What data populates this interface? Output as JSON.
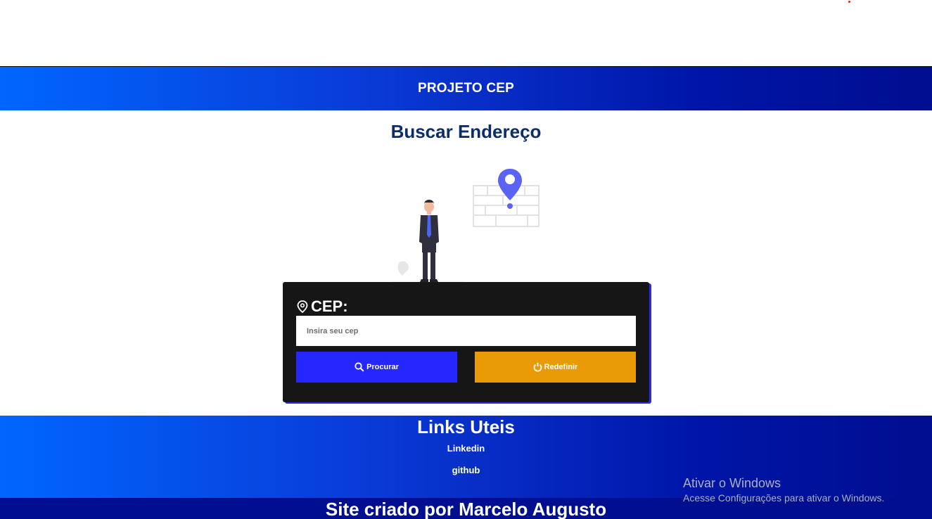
{
  "header": {
    "title": "PROJETO CEP"
  },
  "main": {
    "title": "Buscar Endereço",
    "form": {
      "label": "CEP:",
      "input_placeholder": "Insira seu cep",
      "input_value": "",
      "search_label": "Procurar",
      "reset_label": "Redefinir"
    }
  },
  "links": {
    "title": "Links Uteis",
    "items": [
      {
        "label": "Linkedin"
      },
      {
        "label": "github"
      }
    ]
  },
  "footer": {
    "text": "Site criado por Marcelo Augusto"
  },
  "windows_watermark": {
    "title": "Ativar o Windows",
    "subtitle": "Acesse Configurações para ativar o Windows."
  },
  "icons": {
    "cep": "location-pin-icon",
    "search": "search-icon",
    "reset": "power-reset-icon"
  },
  "colors": {
    "header_gradient_start": "#0066ff",
    "header_gradient_end": "#000e8f",
    "title_color": "#0b2d6b",
    "card_bg": "#161616",
    "search_button": "#2626ff",
    "reset_button": "#e89b06"
  }
}
